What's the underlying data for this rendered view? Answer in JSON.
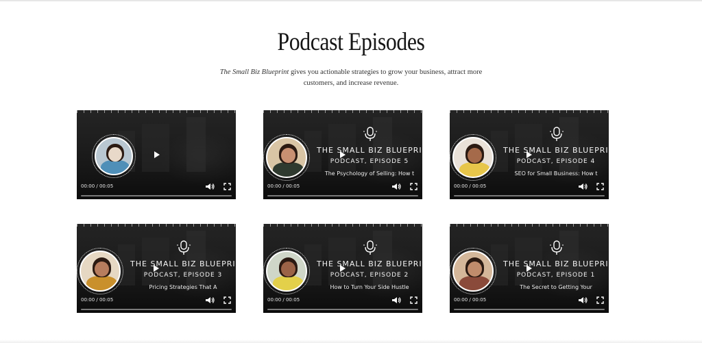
{
  "page": {
    "title": "Podcast Episodes",
    "subtitle_show": "The Small Biz Blueprint",
    "subtitle_rest": " gives you actionable strategies to grow your business, attract more customers, and increase revenue."
  },
  "player": {
    "time": "00:00 / 00:05"
  },
  "episodes": [
    {
      "show": "",
      "episode": "",
      "title": "",
      "time": "00:00 / 00:05",
      "skin": "#e8d9c9",
      "shirt": "#4f8fb8",
      "photo_bg": "#b9c7d1"
    },
    {
      "show": "THE SMALL BIZ BLUEPRINT",
      "episode": "PODCAST, EPISODE 5",
      "title": "The Psychology of Selling: How t",
      "time": "00:00 / 00:05",
      "skin": "#c89072",
      "shirt": "#2f3a2f",
      "photo_bg": "#d9c5a5"
    },
    {
      "show": "THE SMALL BIZ BLUEPRINT",
      "episode": "PODCAST, EPISODE 4",
      "title": "SEO for Small Business: How t",
      "time": "00:00 / 00:05",
      "skin": "#a56a4a",
      "shirt": "#e7c64a",
      "photo_bg": "#e9e1d8"
    },
    {
      "show": "THE SMALL BIZ BLUEPRINT",
      "episode": "PODCAST, EPISODE 3",
      "title": "Pricing Strategies That A",
      "time": "00:00 / 00:05",
      "skin": "#b77d5e",
      "shirt": "#c9902c",
      "photo_bg": "#e6d8c3"
    },
    {
      "show": "THE SMALL BIZ BLUEPRINT",
      "episode": "PODCAST, EPISODE 2",
      "title": "How to Turn Your Side Hustle",
      "time": "00:00 / 00:05",
      "skin": "#9b6347",
      "shirt": "#e3d04a",
      "photo_bg": "#cfd6c8"
    },
    {
      "show": "THE SMALL BIZ BLUEPRINT",
      "episode": "PODCAST, EPISODE 1",
      "title": "The Secret to Getting Your",
      "time": "00:00 / 00:05",
      "skin": "#c08c6c",
      "shirt": "#8a4a3a",
      "photo_bg": "#d4b79a"
    }
  ],
  "icons": {
    "play": "play-icon",
    "volume": "volume-icon",
    "fullscreen": "fullscreen-icon",
    "mic": "microphone-icon"
  }
}
